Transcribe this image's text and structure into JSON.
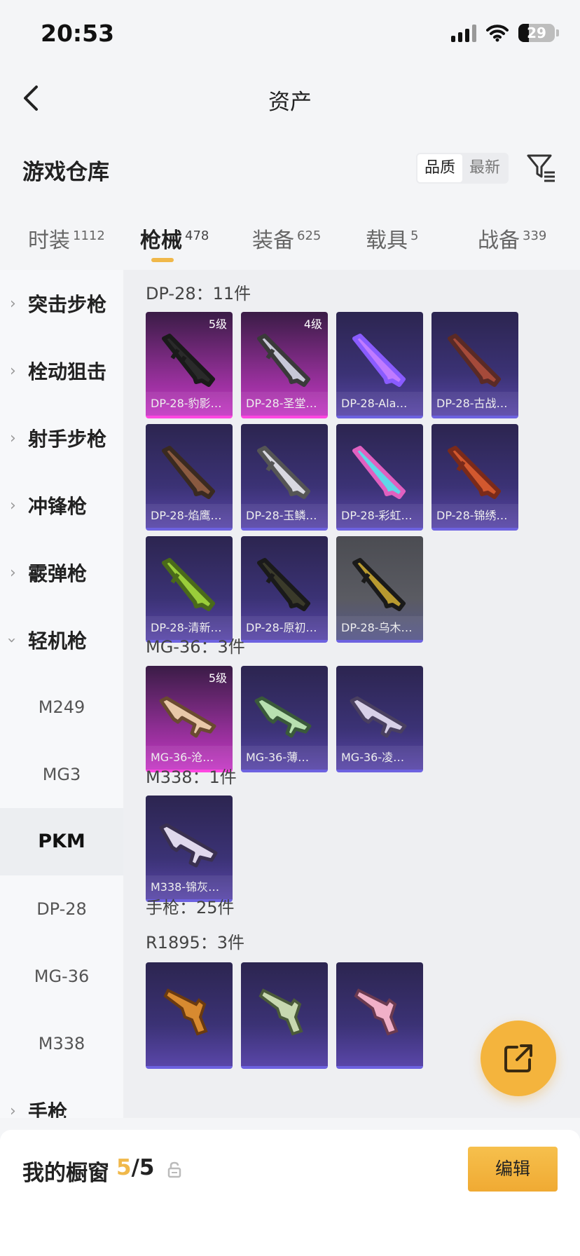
{
  "status_bar": {
    "time": "20:53",
    "battery": "29"
  },
  "header": {
    "title": "资产"
  },
  "warehouse": {
    "title": "游戏仓库",
    "sort": [
      "品质",
      "最新"
    ]
  },
  "tabs": [
    {
      "label": "时装",
      "count": "1112"
    },
    {
      "label": "枪械",
      "count": "478"
    },
    {
      "label": "装备",
      "count": "625"
    },
    {
      "label": "载具",
      "count": "5"
    },
    {
      "label": "战备",
      "count": "339"
    }
  ],
  "sidebar": {
    "categories": [
      "突击步枪",
      "栓动狙击",
      "射手步枪",
      "冲锋枪",
      "霰弹枪",
      "轻机枪"
    ],
    "subs": [
      "M249",
      "MG3",
      "PKM",
      "DP-28",
      "MG-36",
      "M338"
    ],
    "last_category": "手枪"
  },
  "sections": {
    "dp28": "DP-28：11件",
    "mg36": "MG-36：3件",
    "m338": "M338：1件",
    "pistol": "手枪：25件",
    "r1895": "R1895：3件"
  },
  "cards": {
    "dp28": [
      {
        "name": "DP-28-豹影…",
        "level": "5级"
      },
      {
        "name": "DP-28-圣堂…",
        "level": "4级"
      },
      {
        "name": "DP-28-Ala…"
      },
      {
        "name": "DP-28-古战…"
      },
      {
        "name": "DP-28-焰鹰…"
      },
      {
        "name": "DP-28-玉鳞…"
      },
      {
        "name": "DP-28-彩虹…"
      },
      {
        "name": "DP-28-锦绣…"
      },
      {
        "name": "DP-28-清新…"
      },
      {
        "name": "DP-28-原初…"
      },
      {
        "name": "DP-28-乌木…"
      }
    ],
    "mg36": [
      {
        "name": "MG-36-沧…",
        "level": "5级"
      },
      {
        "name": "MG-36-薄…"
      },
      {
        "name": "MG-36-凌…"
      }
    ],
    "m338": [
      {
        "name": "M338-锦灰…"
      }
    ]
  },
  "showcase": {
    "label": "我的橱窗",
    "used": "5",
    "total": "/5",
    "edit": "编辑"
  },
  "colors": {
    "accent": "#f0b84a",
    "card_purple": "#3b3275",
    "card_pink": "#c438c4"
  }
}
